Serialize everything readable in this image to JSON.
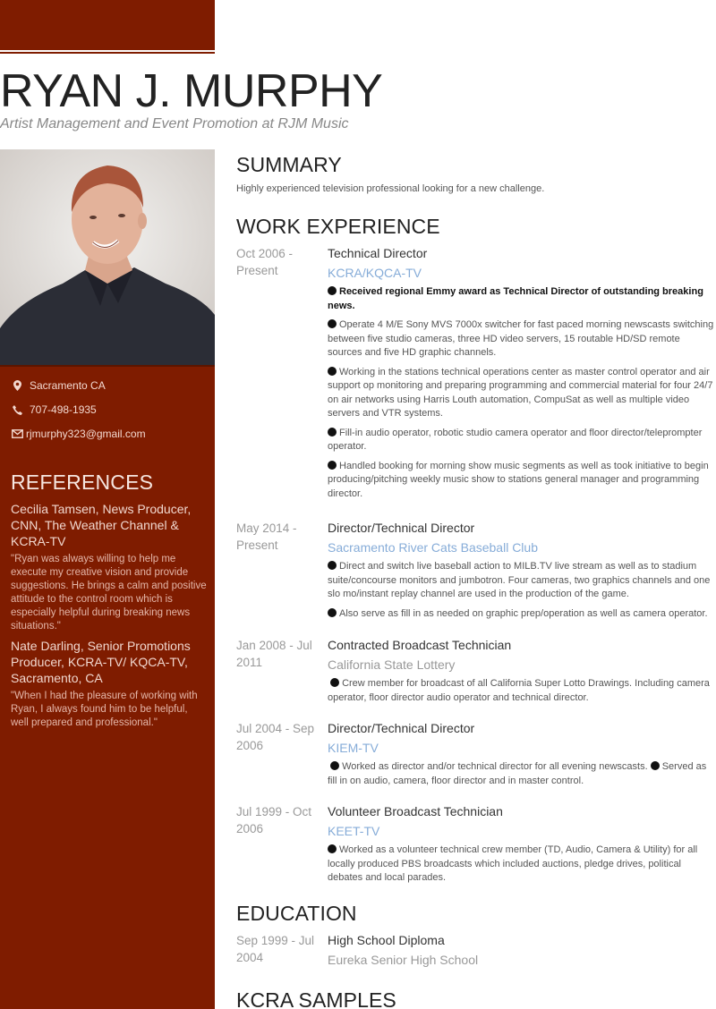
{
  "header": {
    "name": "RYAN J. MURPHY",
    "headline": "Artist Management and Event Promotion at RJM Music"
  },
  "colors": {
    "accent": "#7f1c00",
    "link": "#86acd8"
  },
  "sidebar": {
    "contact": [
      {
        "icon": "map-marker-icon",
        "text": "Sacramento CA"
      },
      {
        "icon": "phone-icon",
        "text": "707-498-1935"
      },
      {
        "icon": "envelope-icon",
        "text": "rjmurphy323@gmail.com"
      }
    ],
    "references_heading": "REFERENCES",
    "references": [
      {
        "name": "Cecilia Tamsen, News Producer, CNN, The Weather Channel & KCRA-TV",
        "quote": "\"Ryan was always willing to help me execute my creative vision and provide suggestions. He brings a calm and positive attitude to the control room which is especially helpful during breaking news situations.\""
      },
      {
        "name": "Nate Darling, Senior Promotions Producer, KCRA-TV/ KQCA-TV, Sacramento, CA",
        "quote": "\"When I had the pleasure of working with Ryan, I always found him to be helpful, well prepared and professional.\""
      }
    ]
  },
  "summary": {
    "heading": "SUMMARY",
    "text": "Highly experienced television professional looking for a new challenge."
  },
  "work": {
    "heading": "WORK EXPERIENCE",
    "jobs": [
      {
        "date": "Oct 2006 - Present",
        "title": "Technical Director",
        "company": "KCRA/KQCA-TV",
        "company_link": true,
        "bullets": [
          "Received regional Emmy award as Technical Director of outstanding breaking news.",
          "Operate 4 M/E Sony MVS 7000x switcher for fast paced morning newscasts switching between five studio cameras, three HD video servers, 15 routable HD/SD remote sources and five HD graphic channels.",
          "Working in the stations technical operations center as master control operator and air support op monitoring and preparing programming and commercial material for four 24/7 on air networks using Harris Louth automation, CompuSat as well as multiple video servers and VTR systems.",
          "Fill-in audio operator, robotic studio camera operator and floor director/teleprompter operator.",
          "Handled booking for morning show music segments as well as took initiative to begin producing/pitching weekly music show to stations general manager and programming director."
        ]
      },
      {
        "date": "May 2014 - Present",
        "title": "Director/Technical Director",
        "company": "Sacramento River Cats Baseball Club",
        "company_link": true,
        "bullets": [
          "Direct and switch live baseball action to MILB.TV live stream as well as to stadium suite/concourse monitors and jumbotron. Four cameras, two graphics channels and one slo mo/instant replay channel are used in the production of the game.",
          "Also serve as fill in as needed on graphic prep/operation as well as camera operator."
        ]
      },
      {
        "date": "Jan 2008 - Jul 2011",
        "title": "Contracted Broadcast Technician",
        "company": "California State Lottery",
        "company_link": false,
        "bullets": [
          "Crew member for broadcast of all California Super Lotto Drawings. Including camera operator, floor director audio operator and technical director."
        ]
      },
      {
        "date": "Jul 2004 - Sep 2006",
        "title": "Director/Technical Director",
        "company": "KIEM-TV",
        "company_link": true,
        "bullets_inline": [
          "Worked as director and/or technical director for all evening newscasts.",
          "Served as fill in on audio, camera, floor director and in master control."
        ]
      },
      {
        "date": "Jul 1999 - Oct 2006",
        "title": "Volunteer Broadcast Technician",
        "company": "KEET-TV",
        "company_link": true,
        "bullets": [
          "Worked as a volunteer technical crew member (TD, Audio, Camera & Utility) for all locally produced PBS broadcasts which included auctions, pledge drives, political debates and local parades."
        ]
      }
    ]
  },
  "education": {
    "heading": "EDUCATION",
    "items": [
      {
        "date": "Sep 1999 - Jul 2004",
        "degree": "High School Diploma",
        "school": "Eureka Senior High School"
      }
    ]
  },
  "samples": {
    "heading": "KCRA SAMPLES"
  }
}
